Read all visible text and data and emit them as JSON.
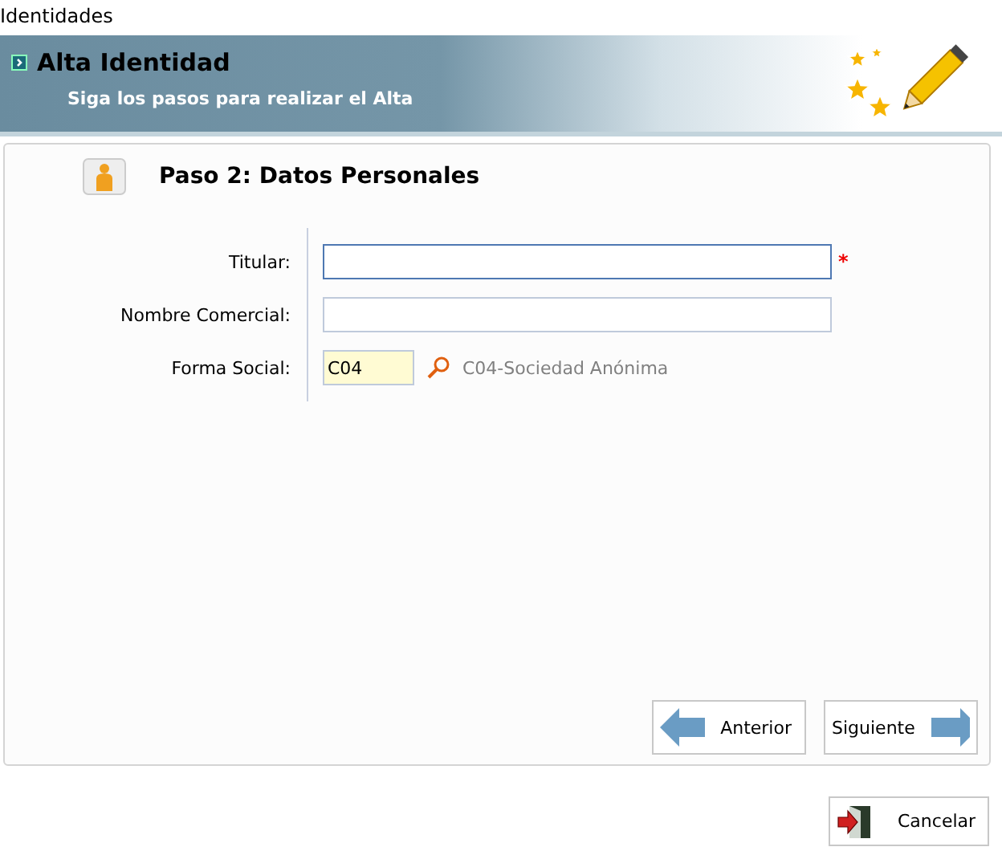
{
  "window": {
    "title": "Identidades"
  },
  "header": {
    "title": "Alta Identidad",
    "subtitle": "Siga los pasos para realizar el Alta"
  },
  "step": {
    "title": "Paso 2: Datos Personales"
  },
  "fields": [
    {
      "label": "Titular:",
      "kind": "text",
      "required_mark": "*",
      "focused": true
    },
    {
      "label": "Nombre Comercial:",
      "kind": "text",
      "focused": false
    },
    {
      "label": "Forma Social:",
      "kind": "lookup",
      "focused": false,
      "value": "C04",
      "description": "C04-Sociedad Anónima"
    }
  ],
  "nav_buttons": [
    {
      "label": "Anterior",
      "kind": "back"
    },
    {
      "label": "Siguiente",
      "kind": "next"
    }
  ],
  "cancel_button": {
    "label": "Cancelar"
  }
}
